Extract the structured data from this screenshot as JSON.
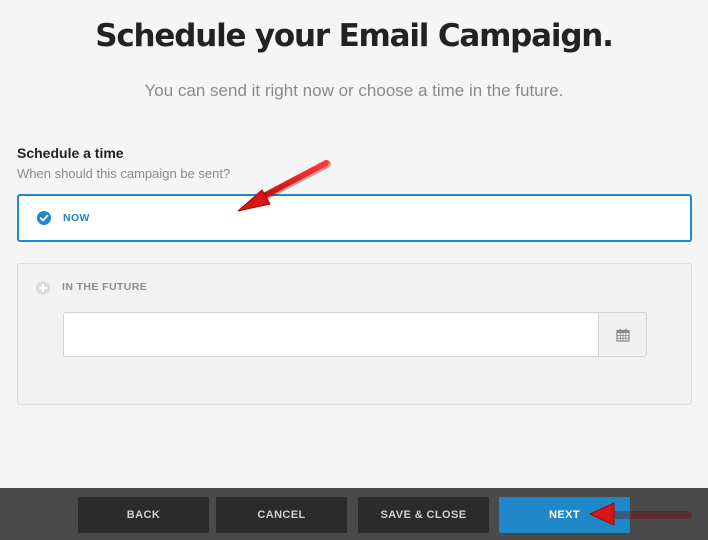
{
  "header": {
    "title": "Schedule your Email Campaign.",
    "subtitle": "You can send it right now or choose a time in the future."
  },
  "schedule": {
    "heading": "Schedule a time",
    "subheading": "When should this campaign be sent?",
    "options": [
      {
        "label": "NOW",
        "selected": true,
        "icon": "check-circle-icon"
      },
      {
        "label": "IN THE FUTURE",
        "selected": false,
        "icon": "plus-circle-icon"
      }
    ],
    "date_input": {
      "value": "",
      "placeholder": "",
      "icon": "calendar-icon"
    }
  },
  "footer": {
    "back_label": "BACK",
    "cancel_label": "CANCEL",
    "save_close_label": "SAVE & CLOSE",
    "next_label": "NEXT"
  },
  "colors": {
    "accent": "#1f88c8",
    "footer_bg": "#4a4a4a",
    "button_dark": "#2b2b2b",
    "annotation_arrow": "#e01b1b"
  }
}
